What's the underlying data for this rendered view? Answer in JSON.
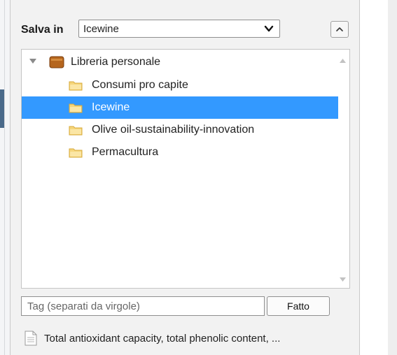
{
  "popup": {
    "save_label": "Salva in",
    "selected_collection": "Icewine",
    "tree": {
      "library": "Libreria personale",
      "collections": [
        "Consumi pro capite",
        "Icewine",
        "Olive oil-sustainability-innovation",
        "Permacultura"
      ],
      "selected_index": 1
    },
    "tags_placeholder": "Tag (separati da virgole)",
    "done_label": "Fatto",
    "item_title": "Total antioxidant capacity, total phenolic content, ..."
  },
  "icons": {
    "library": "library-icon",
    "folder": "folder-icon",
    "document": "document-icon",
    "chevron": "chevron-down-icon",
    "collapse": "chevron-up-icon"
  },
  "colors": {
    "selection": "#3399ff",
    "folder": "#f2c94c",
    "library": "#a0521d"
  }
}
